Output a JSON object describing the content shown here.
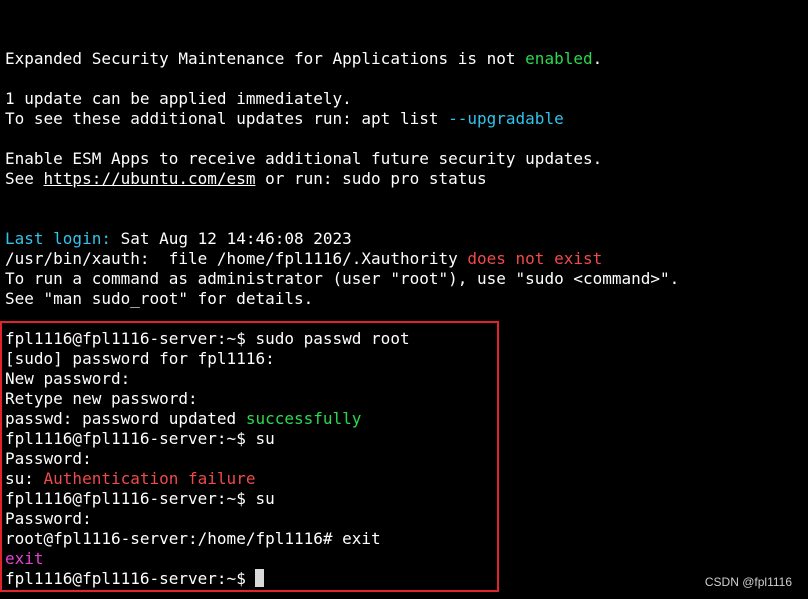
{
  "colors": {
    "background": "#000000",
    "text": "#ffffff",
    "green": "#2bd94f",
    "cyan": "#32c3ec",
    "red": "#f04a4a",
    "magenta": "#e93fd8",
    "highlight_border": "#e0242e"
  },
  "motd": {
    "esm_prefix": "Expanded Security Maintenance for Applications is not ",
    "esm_status": "enabled",
    "esm_suffix": ".",
    "updates_line": "1 update can be applied immediately.",
    "updates_hint_prefix": "To see these additional updates run: apt list ",
    "updates_hint_flag": "--upgradable",
    "esm_apps_line": "Enable ESM Apps to receive additional future security updates.",
    "see_prefix": "See ",
    "esm_link": "https://ubuntu.com/esm",
    "see_suffix": " or run: sudo pro status"
  },
  "login": {
    "last_login_label": "Last login:",
    "last_login_value": " Sat Aug 12 14:46:08 2023",
    "xauth_prefix": "/usr/bin/xauth:  file /home/fpl1116/.Xauthority ",
    "xauth_error": "does not exist",
    "sudo_hint": "To run a command as administrator (user \"root\"), use \"sudo <command>\".",
    "man_hint": "See \"man sudo_root\" for details."
  },
  "session": {
    "line1": "fpl1116@fpl1116-server:~$ sudo passwd root",
    "line2": "[sudo] password for fpl1116:",
    "line3": "New password:",
    "line4": "Retype new password:",
    "line5_prefix": "passwd: password updated ",
    "line5_status": "successfully",
    "line6": "fpl1116@fpl1116-server:~$ su",
    "line7": "Password:",
    "line8_prefix": "su: ",
    "line8_error": "Authentication failure",
    "line9": "fpl1116@fpl1116-server:~$ su",
    "line10": "Password:",
    "line11": "root@fpl1116-server:/home/fpl1116# exit",
    "line12": "exit",
    "prompt": "fpl1116@fpl1116-server:~$ "
  },
  "watermark": "CSDN @fpl1116"
}
